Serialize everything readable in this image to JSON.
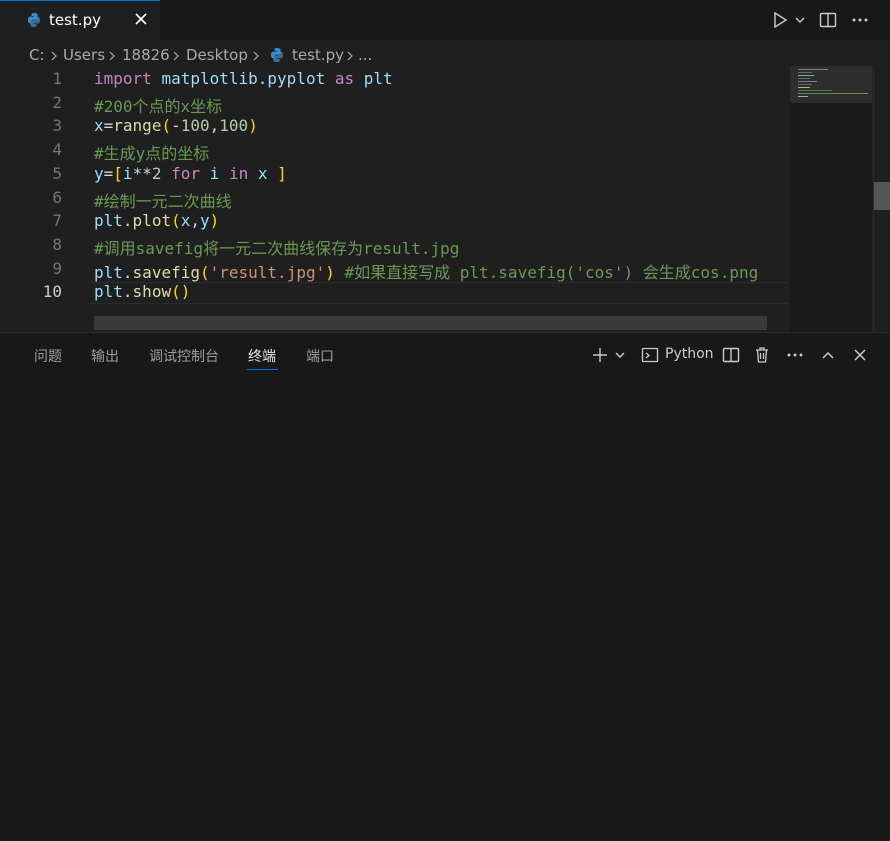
{
  "tab": {
    "label": "test.py"
  },
  "breadcrumb": [
    "C:",
    "Users",
    "18826",
    "Desktop",
    "test.py",
    "..."
  ],
  "editor": {
    "active_line": 10,
    "line_numbers": [
      "1",
      "2",
      "3",
      "4",
      "5",
      "6",
      "7",
      "8",
      "9",
      "10"
    ],
    "lines": [
      [
        [
          "kw",
          "import"
        ],
        [
          "op",
          " "
        ],
        [
          "var",
          "matplotlib"
        ],
        [
          "op",
          "."
        ],
        [
          "var",
          "pyplot"
        ],
        [
          "op",
          " "
        ],
        [
          "kw",
          "as"
        ],
        [
          "op",
          " "
        ],
        [
          "var",
          "plt"
        ]
      ],
      [
        [
          "cmt",
          "#200个点的x坐标"
        ]
      ],
      [
        [
          "var",
          "x"
        ],
        [
          "op",
          "="
        ],
        [
          "fn",
          "range"
        ],
        [
          "b1",
          "("
        ],
        [
          "op",
          "-"
        ],
        [
          "num",
          "100"
        ],
        [
          "op",
          ","
        ],
        [
          "num",
          "100"
        ],
        [
          "b1",
          ")"
        ]
      ],
      [
        [
          "cmt",
          "#生成y点的坐标"
        ]
      ],
      [
        [
          "var",
          "y"
        ],
        [
          "op",
          "="
        ],
        [
          "b1",
          "["
        ],
        [
          "var",
          "i"
        ],
        [
          "op",
          "**"
        ],
        [
          "num",
          "2"
        ],
        [
          "op",
          " "
        ],
        [
          "kw",
          "for"
        ],
        [
          "op",
          " "
        ],
        [
          "var",
          "i"
        ],
        [
          "op",
          " "
        ],
        [
          "kw",
          "in"
        ],
        [
          "op",
          " "
        ],
        [
          "var",
          "x"
        ],
        [
          "op",
          " "
        ],
        [
          "b1",
          "]"
        ]
      ],
      [
        [
          "cmt",
          "#绘制一元二次曲线"
        ]
      ],
      [
        [
          "var",
          "plt"
        ],
        [
          "op",
          "."
        ],
        [
          "fn",
          "plot"
        ],
        [
          "b1",
          "("
        ],
        [
          "var",
          "x"
        ],
        [
          "op",
          ","
        ],
        [
          "var",
          "y"
        ],
        [
          "b1",
          ")"
        ]
      ],
      [
        [
          "cmt",
          "#调用savefig将一元二次曲线保存为result.jpg"
        ]
      ],
      [
        [
          "var",
          "plt"
        ],
        [
          "op",
          "."
        ],
        [
          "fn",
          "savefig"
        ],
        [
          "b1",
          "("
        ],
        [
          "str",
          "'result.jpg'"
        ],
        [
          "b1",
          ")"
        ],
        [
          "op",
          " "
        ],
        [
          "cmt",
          "#如果直接写成 plt.savefig('cos') 会生成cos.png"
        ]
      ],
      [
        [
          "var",
          "plt"
        ],
        [
          "op",
          "."
        ],
        [
          "fn",
          "show"
        ],
        [
          "b1",
          "("
        ],
        [
          "b1",
          ")"
        ]
      ]
    ]
  },
  "panel": {
    "tabs": [
      "问题",
      "输出",
      "调试控制台",
      "终端",
      "端口"
    ],
    "active_tab": "终端",
    "terminal_label": "Python"
  },
  "colors": {
    "accent": "#0078d4",
    "python_icon": "#3b8ccf"
  }
}
